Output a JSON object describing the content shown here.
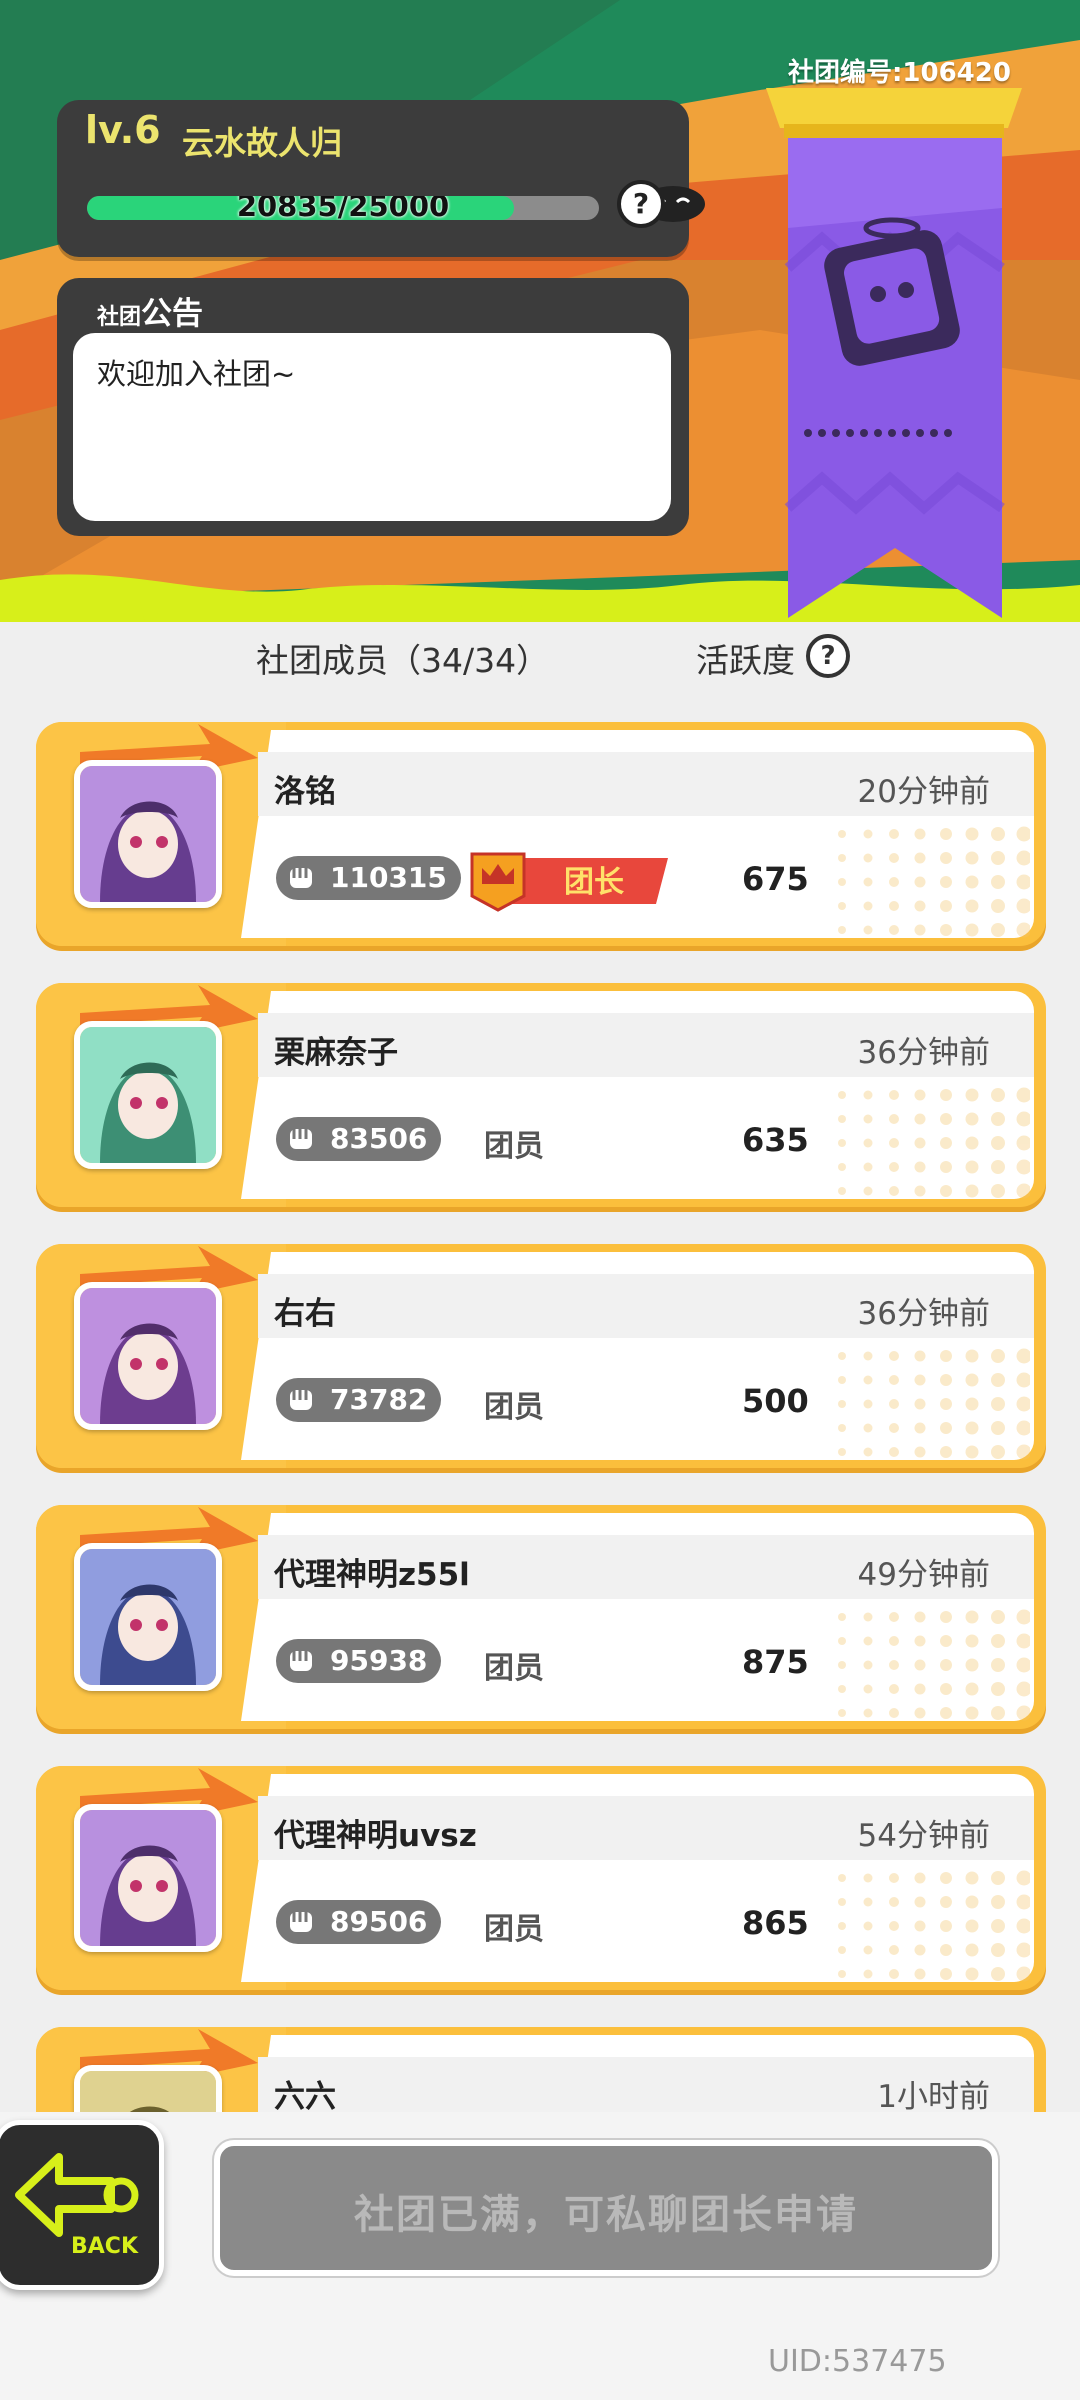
{
  "club": {
    "id_text": "社团编号:106420",
    "level": "lv.6",
    "name": "云水故人归",
    "xp_current": 20835,
    "xp_max": 25000,
    "xp_text": "20835/25000",
    "xp_fraction": 0.8334
  },
  "notice": {
    "title_small": "社团",
    "title_big": "公告",
    "body": "欢迎加入社团~"
  },
  "members_header": {
    "label": "社团成员（34/34）",
    "activity_label": "活跃度"
  },
  "members": [
    {
      "name": "洛铭",
      "time": "20分钟前",
      "power": "110315",
      "role": "团长",
      "activity": "675",
      "is_leader": true
    },
    {
      "name": "栗麻奈子",
      "time": "36分钟前",
      "power": "83506",
      "role": "团员",
      "activity": "635",
      "is_leader": false
    },
    {
      "name": "右右",
      "time": "36分钟前",
      "power": "73782",
      "role": "团员",
      "activity": "500",
      "is_leader": false
    },
    {
      "name": "代理神明z55l",
      "time": "49分钟前",
      "power": "95938",
      "role": "团员",
      "activity": "875",
      "is_leader": false
    },
    {
      "name": "代理神明uvsz",
      "time": "54分钟前",
      "power": "89506",
      "role": "团员",
      "activity": "865",
      "is_leader": false
    },
    {
      "name": "六六",
      "time": "1小时前",
      "power": "",
      "role": "",
      "activity": "",
      "is_leader": false
    }
  ],
  "bottom": {
    "back_label": "BACK",
    "join_label": "社团已满，可私聊团长申请",
    "uid": "UID:537475"
  },
  "icons": {
    "help": "question-mark-icon",
    "power": "fist-icon",
    "leader": "crown-icon",
    "back": "back-arrow-icon"
  },
  "colors": {
    "accent_yellow": "#fcc446",
    "xp_fill": "#2ad47a",
    "banner_purple": "#8a5ae6",
    "leader_red": "#e8473c",
    "lime": "#d7ef1a"
  }
}
